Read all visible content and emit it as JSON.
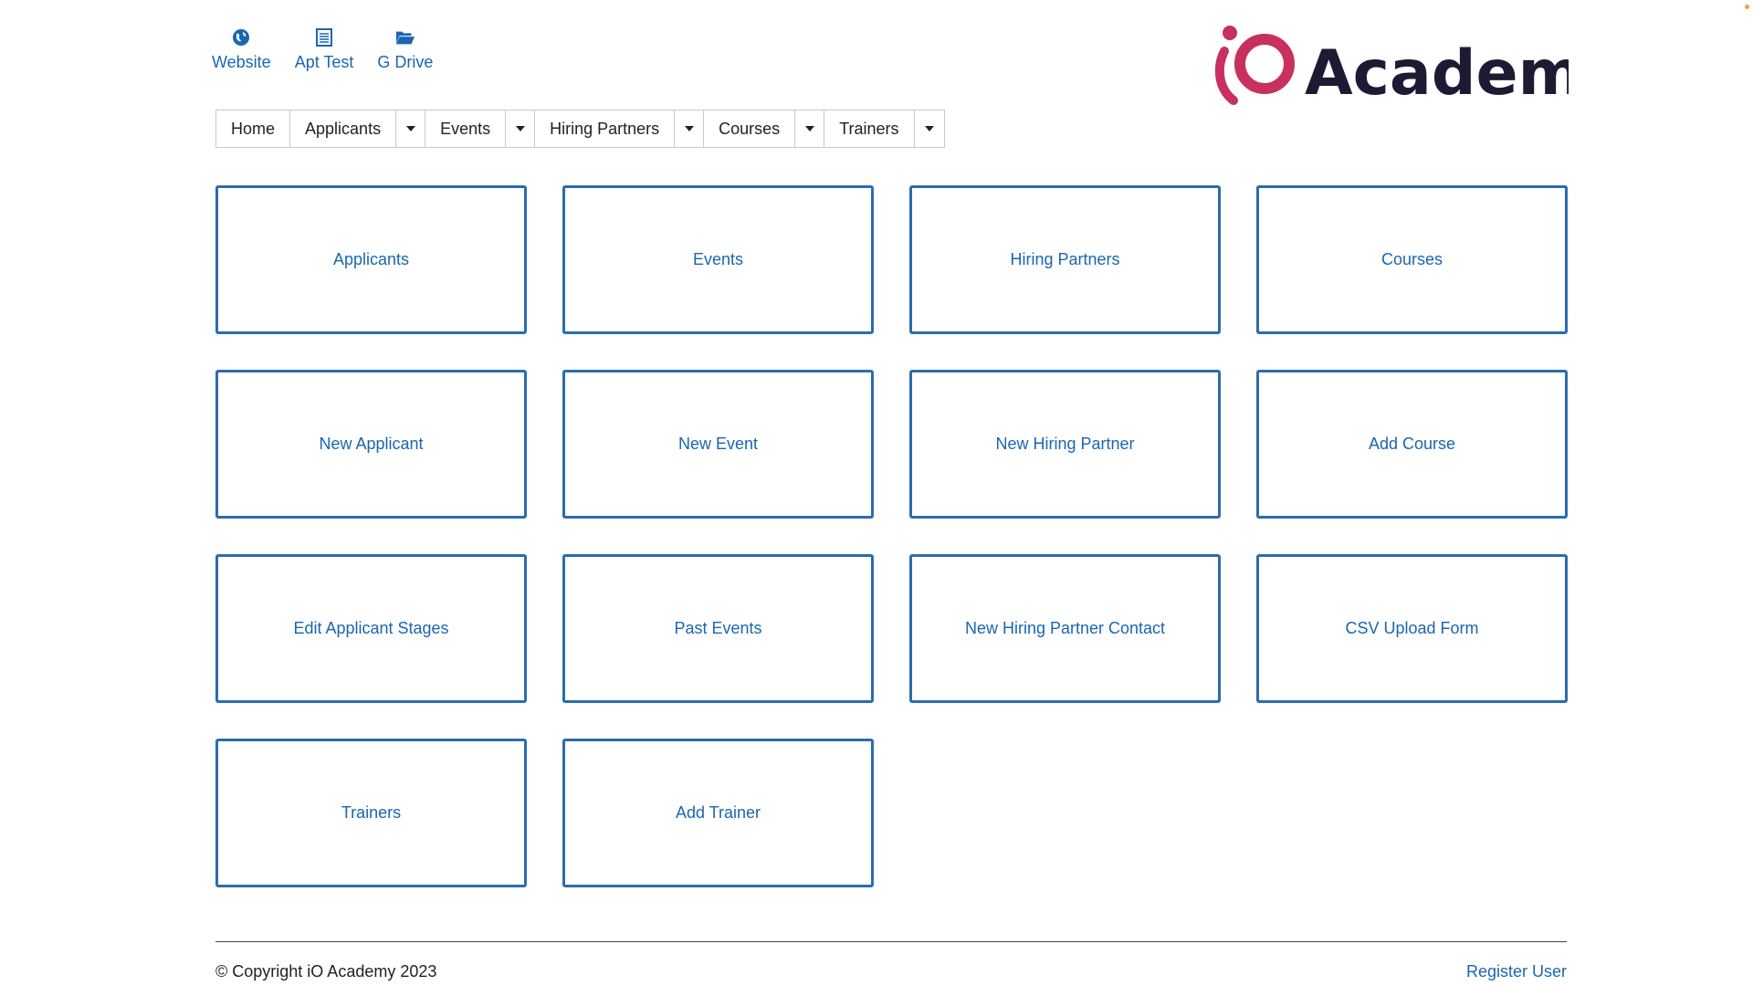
{
  "colors": {
    "link": "#1a66b0",
    "tile_border": "#2b6cb0",
    "logo_mark": "#c7305f",
    "logo_text": "#1d1a33",
    "corner_dot": "#f0a030"
  },
  "quick_links": [
    {
      "label": "Website",
      "icon": "globe-icon"
    },
    {
      "label": "Apt Test",
      "icon": "document-list-icon"
    },
    {
      "label": "G Drive",
      "icon": "folder-open-icon"
    }
  ],
  "logo": {
    "mark": "iO",
    "text": "Academy"
  },
  "nav": {
    "home": "Home",
    "applicants": "Applicants",
    "events": "Events",
    "hiring_partners": "Hiring Partners",
    "courses": "Courses",
    "trainers": "Trainers"
  },
  "tiles": [
    "Applicants",
    "Events",
    "Hiring Partners",
    "Courses",
    "New Applicant",
    "New Event",
    "New Hiring Partner",
    "Add Course",
    "Edit Applicant Stages",
    "Past Events",
    "New Hiring Partner Contact",
    "CSV Upload Form",
    "Trainers",
    "Add Trainer"
  ],
  "footer": {
    "copyright": "© Copyright iO Academy 2023",
    "register": "Register User"
  }
}
